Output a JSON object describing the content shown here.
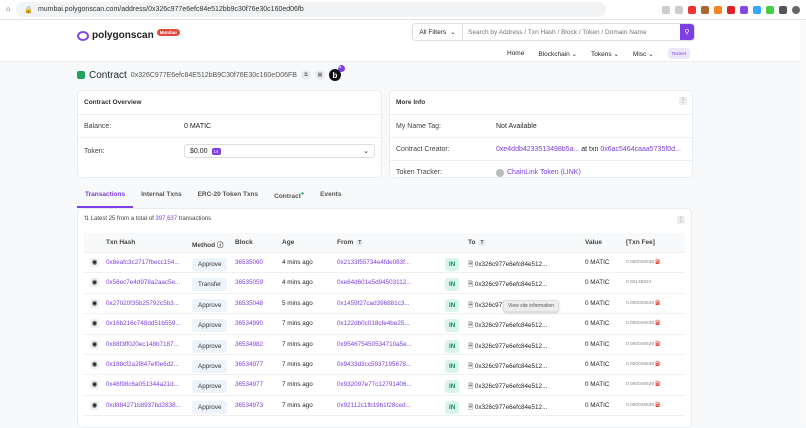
{
  "browser": {
    "url": "mumbai.polygonscan.com/address/0x326c977e6efc84e512bb9c30f76e30c160ed06fb"
  },
  "header": {
    "logo": "polygonscan",
    "network_badge": "Mumbai",
    "filter": "All Filters",
    "search_placeholder": "Search by Address / Txn Hash / Block / Token / Domain Name",
    "nav": [
      "Home",
      "Blockchain",
      "Tokens",
      "Misc"
    ],
    "testnet": "Testnet"
  },
  "contract": {
    "label": "Contract",
    "address": "0x326C977E6efc84E512bB9C30f76E30c160eD06FB",
    "blockscan_badge": "16"
  },
  "overview": {
    "title": "Contract Overview",
    "balance_label": "Balance:",
    "balance": "0 MATIC",
    "token_label": "Token:",
    "token_value": "$0.00",
    "token_count": "14"
  },
  "more_info": {
    "title": "More Info",
    "name_tag_label": "My Name Tag:",
    "name_tag": "Not Available",
    "creator_label": "Contract Creator:",
    "creator": "0xe4ddb4233513498b5a...",
    "at_txn": "at txn",
    "creator_txn": "0x6ac5464caaa5735f0d...",
    "tracker_label": "Token Tracker:",
    "tracker": "ChainLink Token (LINK)"
  },
  "tabs": [
    "Transactions",
    "Internal Txns",
    "ERC-20 Token Txns",
    "Contract",
    "Events"
  ],
  "table": {
    "summary_prefix": "Latest 25 from a total of",
    "total": "397,637",
    "summary_suffix": "transactions",
    "columns": [
      "Txn Hash",
      "Method",
      "Block",
      "Age",
      "From",
      "To",
      "Value",
      "[Txn Fee]"
    ],
    "rows": [
      {
        "hash": "0x8eafc3c2717fbecc154...",
        "method": "Approve",
        "block": "36535060",
        "age": "4 mins ago",
        "from": "0x2133f55734e4fde083f...",
        "dir": "IN",
        "to": "0x326c977e6efc84e512...",
        "value": "0 MATIC",
        "fee": "0.000046539"
      },
      {
        "hash": "0x56ec7e4d978a2aac5e...",
        "method": "Transfer",
        "block": "36535059",
        "age": "4 mins ago",
        "from": "0xe84d601e5d94503112...",
        "dir": "IN",
        "to": "0x326c977e6efc84e512...",
        "value": "0 MATIC",
        "fee": "0.00138824"
      },
      {
        "hash": "0x27020f35b25792c5b3...",
        "method": "Approve",
        "block": "36535048",
        "age": "5 mins ago",
        "from": "0x1459f27cad396881c3...",
        "dir": "IN",
        "to": "0x326c977e6efc84e512...",
        "value": "0 MATIC",
        "fee": "0.000026539"
      },
      {
        "hash": "0x16b216c748dd51b559...",
        "method": "Approve",
        "block": "36534990",
        "age": "7 mins ago",
        "from": "0x122db0c018cfe4be25...",
        "dir": "IN",
        "to": "0x326c977e6efc84e512...",
        "value": "0 MATIC",
        "fee": "0.000046539"
      },
      {
        "hash": "0x88f3ff020ec148b7187...",
        "method": "Approve",
        "block": "36534982",
        "age": "7 mins ago",
        "from": "0x954675450534710a5e...",
        "dir": "IN",
        "to": "0x326c977e6efc84e512...",
        "value": "0 MATIC",
        "fee": "0.000046539"
      },
      {
        "hash": "0x188cf2a2f847ef0e6d2...",
        "method": "Approve",
        "block": "36534977",
        "age": "7 mins ago",
        "from": "0x9433d3cc5937195678...",
        "dir": "IN",
        "to": "0x326c977e6efc84e512...",
        "value": "0 MATIC",
        "fee": "0.000046539"
      },
      {
        "hash": "0x46f98c6a051344a21d...",
        "method": "Approve",
        "block": "36534977",
        "age": "7 mins ago",
        "from": "0x932097e77c12791406...",
        "dir": "IN",
        "to": "0x326c977e6efc84e512...",
        "value": "0 MATIC",
        "fee": "0.000046539"
      },
      {
        "hash": "0xd884271b8937bd2838...",
        "method": "Approve",
        "block": "36534973",
        "age": "7 mins ago",
        "from": "0x92112c1fb19b1f28ced...",
        "dir": "IN",
        "to": "0x326c977e6efc84e512...",
        "value": "0 MATIC",
        "fee": "0.000046539"
      }
    ]
  },
  "tooltip": "View site information"
}
